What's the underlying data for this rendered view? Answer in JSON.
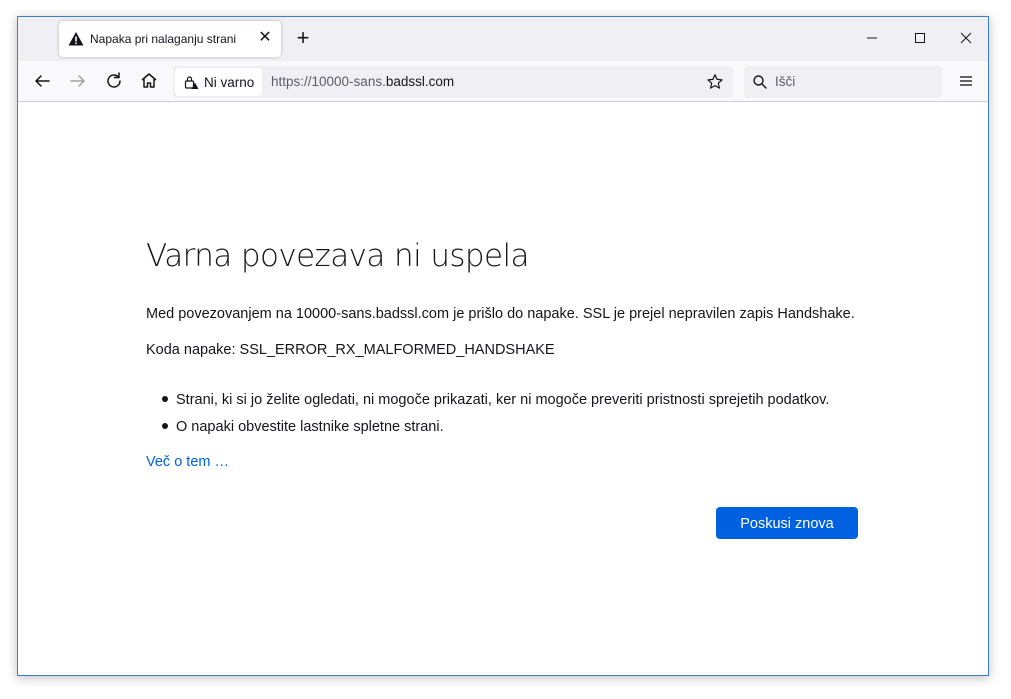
{
  "browser": {
    "tab": {
      "title": "Napaka pri nalaganju strani",
      "icon": "warning-icon",
      "close": "✕"
    },
    "new_tab": "+",
    "window_controls": [
      "minimize-icon",
      "maximize-icon",
      "close-icon"
    ],
    "nav": {
      "identity_label": "Ni varno",
      "url_prefix": "https://10000-sans.",
      "url_host": "badssl.com",
      "search_placeholder": "Išči"
    }
  },
  "page": {
    "title": "Varna povezava ni uspela",
    "description": "Med povezovanjem na 10000-sans.badssl.com je prišlo do napake. SSL je prejel nepravilen zapis Handshake.",
    "error_code": "Koda napake: SSL_ERROR_RX_MALFORMED_HANDSHAKE",
    "bullets": [
      "Strani, ki si jo želite ogledati, ni mogoče prikazati, ker ni mogoče preveriti pristnosti sprejetih podatkov.",
      "O napaki obvestite lastnike spletne strani."
    ],
    "learn_more": "Več o tem …",
    "retry_button": "Poskusi znova"
  },
  "colors": {
    "accent": "#0061e0",
    "window_border": "#3c7fc8",
    "toolbar": "#f9f9fb",
    "tabstrip": "#f0f0f4"
  }
}
